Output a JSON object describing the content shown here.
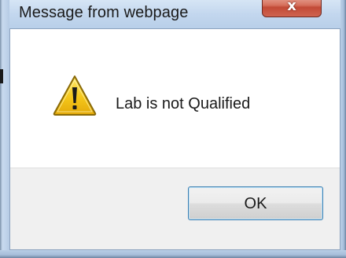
{
  "window": {
    "title": "Message from webpage",
    "close_label": "x"
  },
  "dialog": {
    "icon": "warning-icon",
    "message": "Lab is not Qualified",
    "ok_label": "OK"
  },
  "colors": {
    "frame": "#c7daee",
    "close_button": "#c24a36",
    "button_area": "#f0f0f0",
    "ok_border": "#3c7fb1",
    "warning_fill": "#f5c71a"
  }
}
